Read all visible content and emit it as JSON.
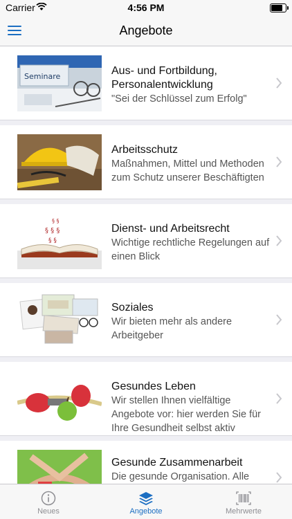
{
  "status_bar": {
    "carrier": "Carrier",
    "time": "4:56 PM",
    "battery_level": 0.9
  },
  "nav": {
    "title": "Angebote"
  },
  "items": [
    {
      "title": "Aus- und Fortbildung, Personalentwicklung",
      "subtitle": "\"Sei der Schlüssel zum Erfolg\"",
      "image_label": "Seminare"
    },
    {
      "title": "Arbeitsschutz",
      "subtitle": "Maßnahmen, Mittel und Methoden zum Schutz unserer Beschäftigten"
    },
    {
      "title": "Dienst- und Arbeitsrecht",
      "subtitle": "Wichtige rechtliche Regelungen auf einen Blick"
    },
    {
      "title": "Soziales",
      "subtitle": "Wir bieten mehr als andere Arbeitgeber"
    },
    {
      "title": "Gesundes Leben",
      "subtitle": "Wir stellen Ihnen vielfältige Angebote vor: hier werden Sie für Ihre Gesundheit selbst aktiv"
    },
    {
      "title": "Gesunde Zusammenarbeit",
      "subtitle": "Die gesunde Organisation. Alle Maßnahmen folgen einer"
    }
  ],
  "tabs": [
    {
      "label": "Neues",
      "icon": "info-icon"
    },
    {
      "label": "Angebote",
      "icon": "layers-icon",
      "active": true
    },
    {
      "label": "Mehrwerte",
      "icon": "barcode-icon"
    }
  ],
  "colors": {
    "accent": "#1b6ec2",
    "inactive": "#8e8e93"
  }
}
